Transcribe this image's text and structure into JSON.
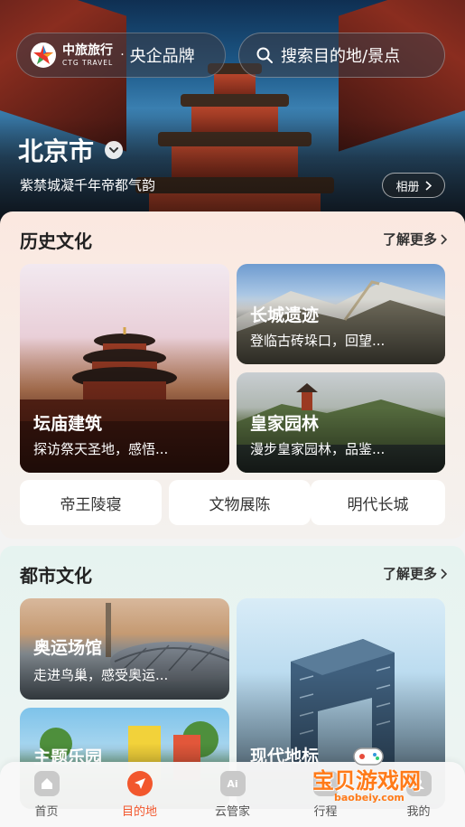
{
  "header": {
    "brand_cn": "中旅旅行",
    "brand_en": "CTG TRAVEL",
    "brand_dot": "·",
    "brand_slogan": "央企品牌",
    "search_placeholder": "搜索目的地/景点"
  },
  "city": {
    "name": "北京市",
    "slogan": "紫禁城凝千年帝都气韵",
    "album_label": "相册"
  },
  "history": {
    "title": "历史文化",
    "more": "了解更多",
    "cards": [
      {
        "title": "坛庙建筑",
        "subtitle": "探访祭天圣地，感悟..."
      },
      {
        "title": "长城遗迹",
        "subtitle": "登临古砖垛口，回望..."
      },
      {
        "title": "皇家园林",
        "subtitle": "漫步皇家园林，品鉴..."
      }
    ],
    "chips": [
      "帝王陵寝",
      "文物展陈",
      "明代长城"
    ]
  },
  "urban": {
    "title": "都市文化",
    "more": "了解更多",
    "cards": [
      {
        "title": "奥运场馆",
        "subtitle": "走进鸟巢，感受奥运..."
      },
      {
        "title": "主题乐园",
        "subtitle": ""
      },
      {
        "title": "现代地标",
        "subtitle": ""
      }
    ]
  },
  "nav": {
    "items": [
      {
        "label": "首页",
        "icon": "home-icon"
      },
      {
        "label": "目的地",
        "icon": "location-arrow-icon"
      },
      {
        "label": "云管家",
        "icon": "ai-icon"
      },
      {
        "label": "行程",
        "icon": "itinerary-icon"
      },
      {
        "label": "我的",
        "icon": "profile-icon"
      }
    ],
    "ai_badge": "Ai"
  },
  "watermark": {
    "text": "宝贝游戏网",
    "sub": "baobeiy.com"
  },
  "colors": {
    "accent": "#f2572d",
    "history_bg": "#fbe8e0",
    "urban_bg": "#e6f3f0"
  }
}
